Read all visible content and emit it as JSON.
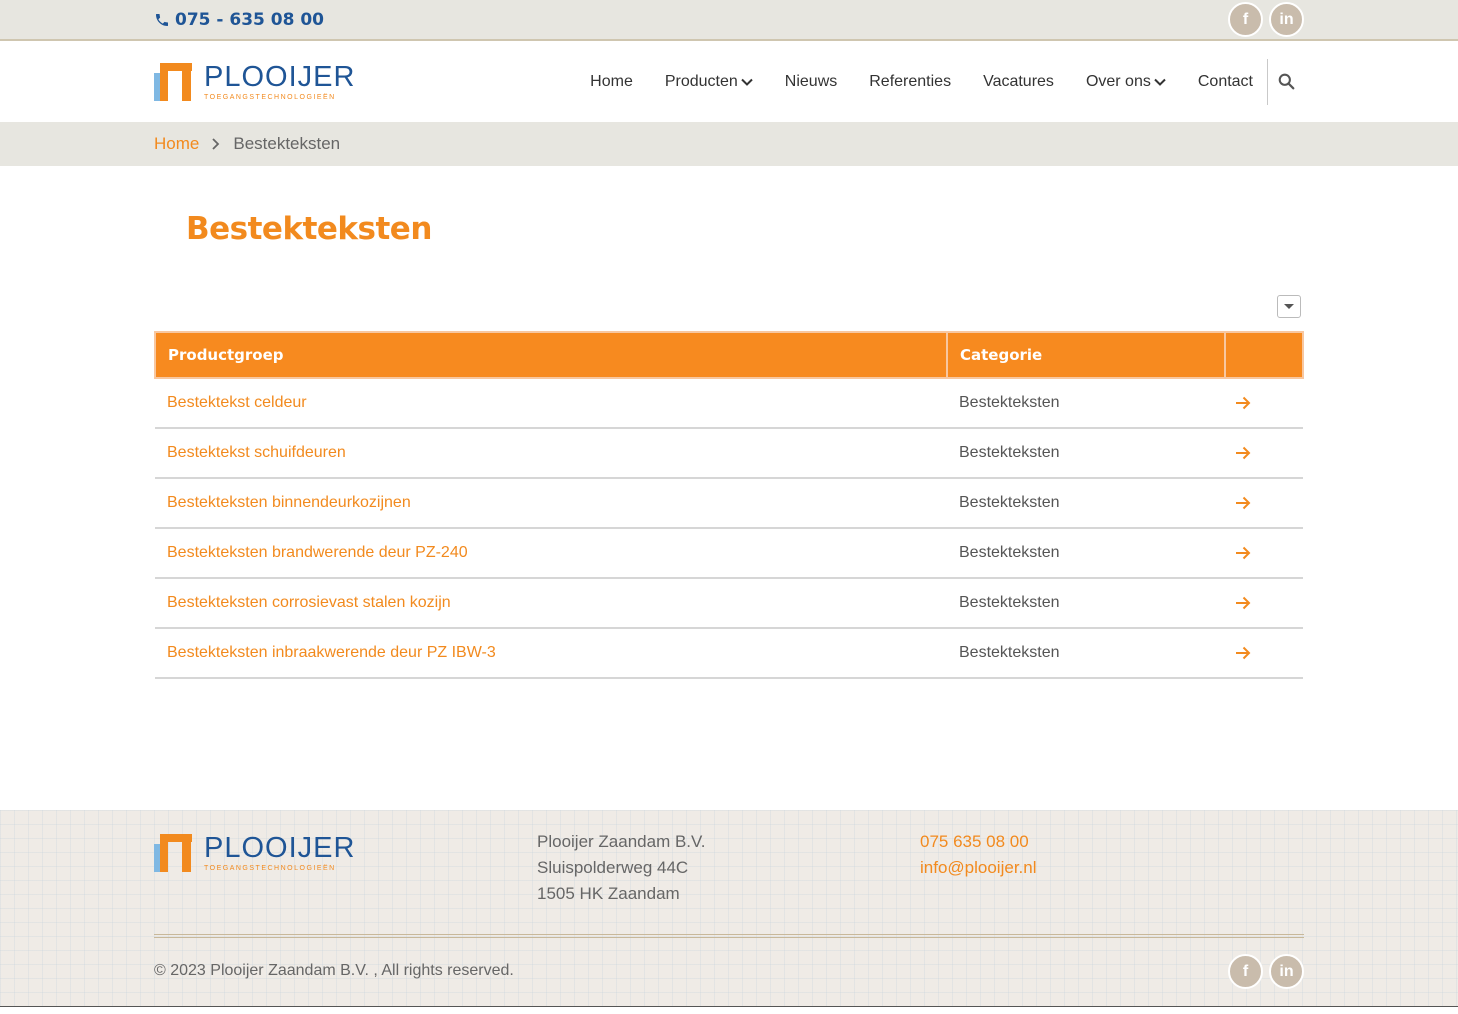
{
  "topbar": {
    "phone": "075 - 635 08 00",
    "socials": [
      {
        "label": "f",
        "icon": "facebook-icon"
      },
      {
        "label": "in",
        "icon": "linkedin-icon"
      }
    ]
  },
  "logo": {
    "name": "PLOOIJER",
    "subtitle": "TOEGANGSTECHNOLOGIEËN"
  },
  "nav": {
    "items": [
      "Home",
      "Producten",
      "Nieuws",
      "Referenties",
      "Vacatures",
      "Over ons",
      "Contact"
    ]
  },
  "breadcrumb": {
    "home": "Home",
    "current": "Bestekteksten"
  },
  "page": {
    "title": "Bestekteksten"
  },
  "table": {
    "headers": [
      "Productgroep",
      "Categorie",
      ""
    ],
    "rows": [
      {
        "name": "Bestektekst celdeur",
        "category": "Bestekteksten"
      },
      {
        "name": "Bestektekst schuifdeuren",
        "category": "Bestekteksten"
      },
      {
        "name": "Bestekteksten binnendeurkozijnen",
        "category": "Bestekteksten"
      },
      {
        "name": "Bestekteksten brandwerende deur PZ-240",
        "category": "Bestekteksten"
      },
      {
        "name": "Bestekteksten corrosievast stalen kozijn",
        "category": "Bestekteksten"
      },
      {
        "name": "Bestekteksten inbraakwerende deur PZ IBW-3",
        "category": "Bestekteksten"
      }
    ]
  },
  "footer": {
    "address": [
      "Plooijer Zaandam B.V.",
      "Sluispolderweg 44C",
      "1505 HK Zaandam"
    ],
    "phone": "075 635 08 00",
    "email": "info@plooijer.nl",
    "copyright": "© 2023 Plooijer Zaandam B.V. , All rights reserved."
  },
  "colors": {
    "accent": "#f28a1e",
    "brand_blue": "#1f5596",
    "bar_bg": "#e7e6e0"
  }
}
